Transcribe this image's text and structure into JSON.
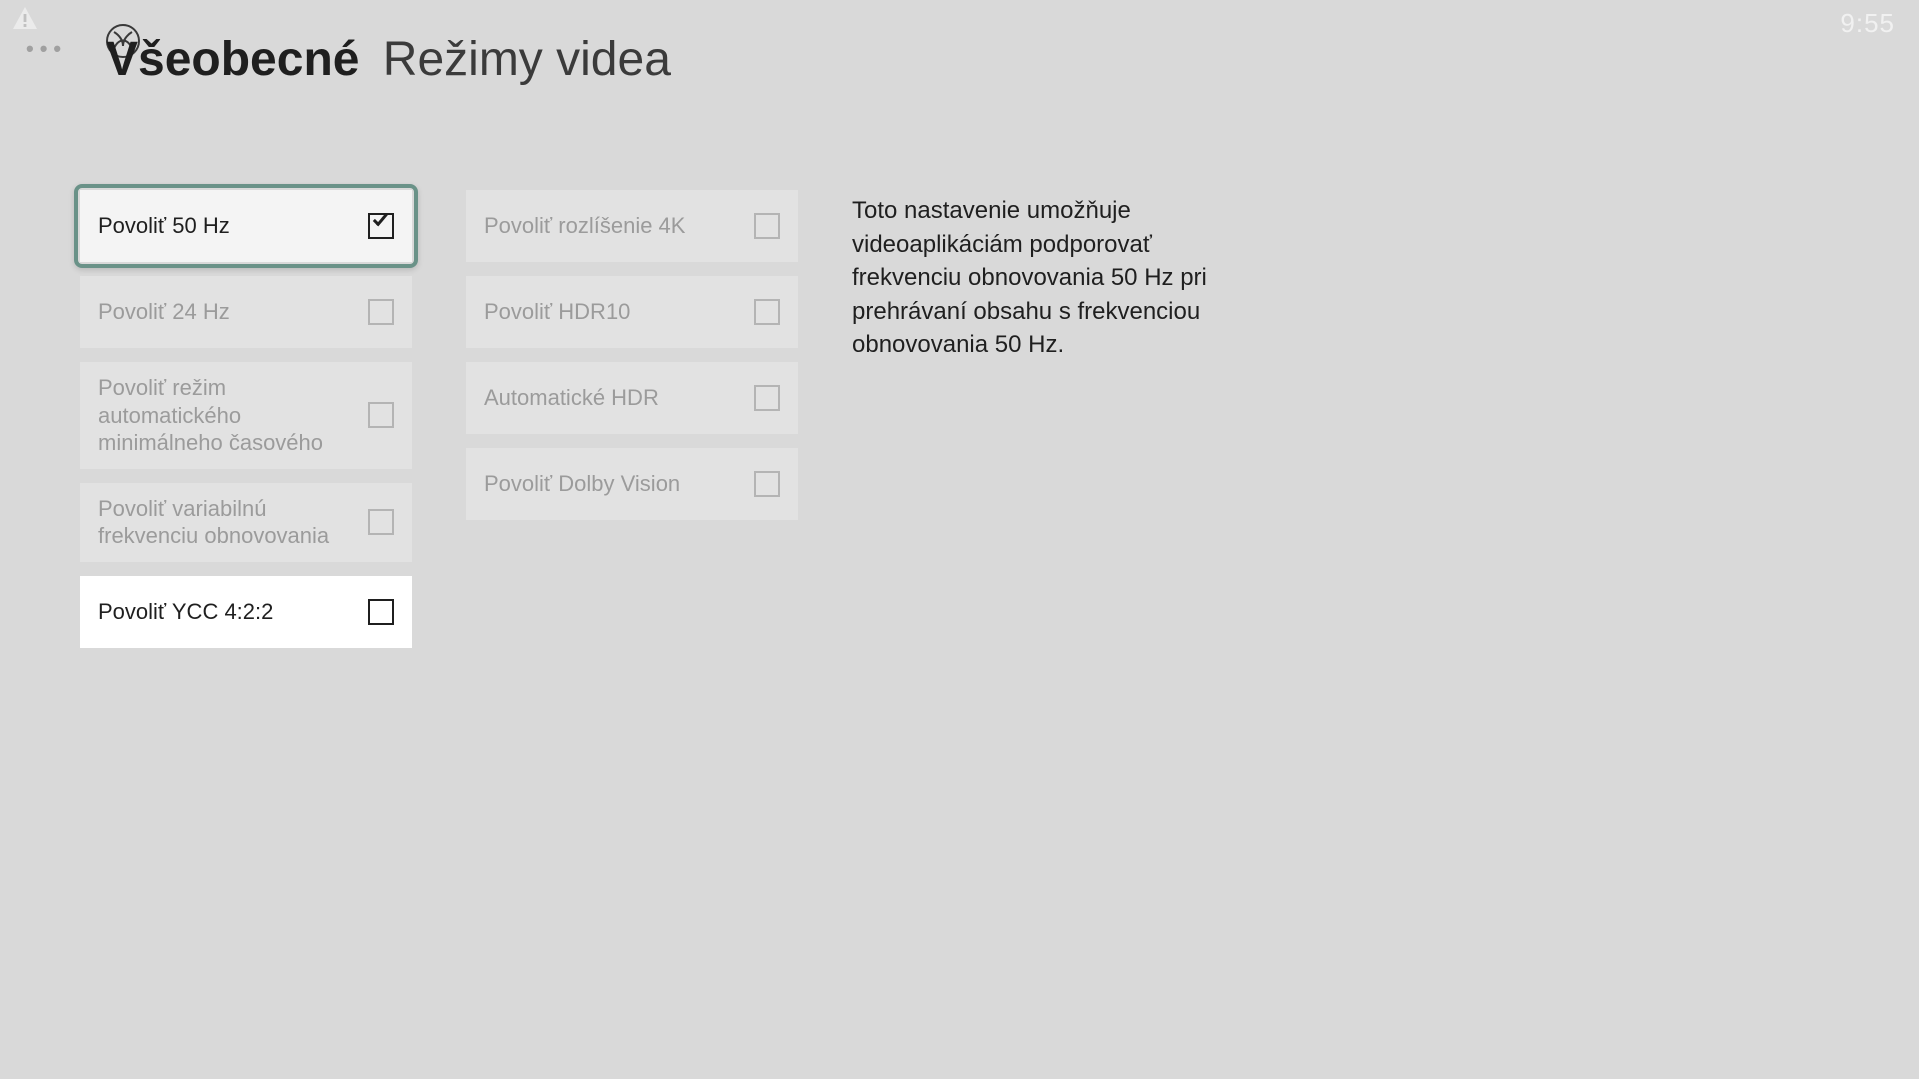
{
  "status_bar": {
    "time": "9:55"
  },
  "breadcrumb": {
    "section": "Všeobecné",
    "page": "Režimy videa"
  },
  "options_col1": [
    {
      "label": "Povoliť 50 Hz",
      "checked": true,
      "disabled": false,
      "selected": true
    },
    {
      "label": "Povoliť 24 Hz",
      "checked": false,
      "disabled": true,
      "selected": false
    },
    {
      "label": "Povoliť režim automatického minimálneho časového",
      "checked": false,
      "disabled": true,
      "selected": false,
      "tall": true
    },
    {
      "label": "Povoliť variabilnú frekvenciu obnovovania",
      "checked": false,
      "disabled": true,
      "selected": false,
      "tall": true
    },
    {
      "label": "Povoliť YCC 4:2:2",
      "checked": false,
      "disabled": false,
      "selected": false
    }
  ],
  "options_col2": [
    {
      "label": "Povoliť rozlíšenie 4K",
      "checked": false,
      "disabled": true,
      "selected": false
    },
    {
      "label": "Povoliť HDR10",
      "checked": false,
      "disabled": true,
      "selected": false
    },
    {
      "label": "Automatické HDR",
      "checked": false,
      "disabled": true,
      "selected": false
    },
    {
      "label": "Povoliť Dolby Vision",
      "checked": false,
      "disabled": true,
      "selected": false
    }
  ],
  "description": "Toto nastavenie umožňuje videoaplikáciám podporovať frekvenciu obnovovania 50 Hz pri prehrávaní obsahu s frekvenciou obnovovania 50 Hz."
}
